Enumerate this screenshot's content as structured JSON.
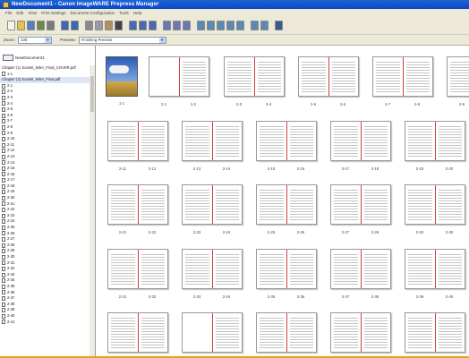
{
  "window": {
    "title": "NewDocument1 - Canon ImageWARE Prepress Manager"
  },
  "menu": [
    "File",
    "Edit",
    "View",
    "Print Settings",
    "Document Configuration",
    "Tools",
    "Help"
  ],
  "toolbar": {
    "buttons": [
      {
        "icon": "new-document-icon",
        "color": "#f5f5f0"
      },
      {
        "icon": "open-folder-icon",
        "color": "#e6c247"
      },
      {
        "icon": "save-icon",
        "color": "#5b7cc4"
      },
      {
        "icon": "scan-icon",
        "color": "#6a8a4a"
      },
      {
        "icon": "print-icon",
        "color": "#7a7a7a"
      },
      {
        "icon": "undo-icon",
        "color": "#3a6ab0"
      },
      {
        "icon": "redo-icon",
        "color": "#3a6ab0"
      },
      {
        "icon": "cut-icon",
        "color": "#8a8a8a"
      },
      {
        "icon": "copy-icon",
        "color": "#9a9aa8"
      },
      {
        "icon": "paste-icon",
        "color": "#b09060"
      },
      {
        "icon": "delete-icon",
        "color": "#444444"
      },
      {
        "icon": "insert-page-icon",
        "color": "#4a6ab0"
      },
      {
        "icon": "insert-blank-icon",
        "color": "#4a6ab0"
      },
      {
        "icon": "insert-sheet-icon",
        "color": "#4a6ab0"
      },
      {
        "icon": "chapter-icon",
        "color": "#6a7ab0"
      },
      {
        "icon": "merge-chapter-icon",
        "color": "#6a7ab0"
      },
      {
        "icon": "split-chapter-icon",
        "color": "#6a7ab0"
      },
      {
        "icon": "finishing-icon",
        "color": "#5a8ab0"
      },
      {
        "icon": "tab-paper-icon",
        "color": "#5a8ab0"
      },
      {
        "icon": "page-settings-icon",
        "color": "#5a8ab0"
      },
      {
        "icon": "paper-settings-icon",
        "color": "#5a8ab0"
      },
      {
        "icon": "edit-page-icon",
        "color": "#5a8ab0"
      },
      {
        "icon": "preview-icon",
        "color": "#5a8ab0"
      },
      {
        "icon": "properties-icon",
        "color": "#5a8ab0"
      },
      {
        "icon": "help-icon",
        "color": "#3a5a90"
      }
    ]
  },
  "viewbar": {
    "zoom_label": "Zoom:",
    "zoom_value": "100",
    "preview_label": "Preview:",
    "preview_value": "Finishing Preview"
  },
  "sidebar": {
    "document_name": "NewDocument1",
    "tree": [
      {
        "type": "chapter",
        "label": "Chapter (1) Scarlet_letter_Final_COVER.pdf"
      },
      {
        "type": "page",
        "label": "1-1"
      },
      {
        "type": "chapter",
        "label": "Chapter (2) Scarlet_letter_Final.pdf"
      },
      {
        "type": "page",
        "label": "2-1"
      },
      {
        "type": "page",
        "label": "2-2"
      },
      {
        "type": "page",
        "label": "2-3"
      },
      {
        "type": "page",
        "label": "2-4"
      },
      {
        "type": "page",
        "label": "2-5"
      },
      {
        "type": "page",
        "label": "2-6"
      },
      {
        "type": "page",
        "label": "2-7"
      },
      {
        "type": "page",
        "label": "2-8"
      },
      {
        "type": "page",
        "label": "2-9"
      },
      {
        "type": "page",
        "label": "2-10"
      },
      {
        "type": "page",
        "label": "2-11"
      },
      {
        "type": "page",
        "label": "2-12"
      },
      {
        "type": "page",
        "label": "2-13"
      },
      {
        "type": "page",
        "label": "2-14"
      },
      {
        "type": "page",
        "label": "2-15"
      },
      {
        "type": "page",
        "label": "2-16"
      },
      {
        "type": "page",
        "label": "2-17"
      },
      {
        "type": "page",
        "label": "2-18"
      },
      {
        "type": "page",
        "label": "2-19"
      },
      {
        "type": "page",
        "label": "2-20"
      },
      {
        "type": "page",
        "label": "2-21"
      },
      {
        "type": "page",
        "label": "2-22"
      },
      {
        "type": "page",
        "label": "2-23"
      },
      {
        "type": "page",
        "label": "2-24"
      },
      {
        "type": "page",
        "label": "2-25"
      },
      {
        "type": "page",
        "label": "2-26"
      },
      {
        "type": "page",
        "label": "2-27"
      },
      {
        "type": "page",
        "label": "2-28"
      },
      {
        "type": "page",
        "label": "2-29"
      },
      {
        "type": "page",
        "label": "2-30"
      },
      {
        "type": "page",
        "label": "2-31"
      },
      {
        "type": "page",
        "label": "2-32"
      },
      {
        "type": "page",
        "label": "2-33"
      },
      {
        "type": "page",
        "label": "2-34"
      },
      {
        "type": "page",
        "label": "2-35"
      },
      {
        "type": "page",
        "label": "2-36"
      },
      {
        "type": "page",
        "label": "2-37"
      },
      {
        "type": "page",
        "label": "2-38"
      },
      {
        "type": "page",
        "label": "2-39"
      },
      {
        "type": "page",
        "label": "2-40"
      },
      {
        "type": "page",
        "label": "2-41"
      }
    ]
  },
  "thumbnails": {
    "rows": [
      [
        {
          "kind": "cover",
          "labels": [
            "1-1"
          ]
        },
        {
          "kind": "spread",
          "blank_left": true,
          "labels": [
            "2-1",
            "2-2"
          ]
        },
        {
          "kind": "spread",
          "labels": [
            "2-3",
            "2-4"
          ]
        },
        {
          "kind": "spread",
          "labels": [
            "2-5",
            "2-6"
          ]
        },
        {
          "kind": "spread",
          "labels": [
            "2-7",
            "2-8"
          ]
        },
        {
          "kind": "spread",
          "labels": [
            "2-9"
          ]
        }
      ],
      [
        {
          "kind": "spread",
          "labels": [
            "2-11",
            "2-12"
          ]
        },
        {
          "kind": "spread",
          "labels": [
            "2-13",
            "2-14"
          ]
        },
        {
          "kind": "spread",
          "labels": [
            "2-15",
            "2-16"
          ]
        },
        {
          "kind": "spread",
          "labels": [
            "2-17",
            "2-18"
          ]
        },
        {
          "kind": "spread",
          "labels": [
            "2-19",
            "2-20"
          ]
        }
      ],
      [
        {
          "kind": "spread",
          "labels": [
            "2-21",
            "2-22"
          ]
        },
        {
          "kind": "spread",
          "labels": [
            "2-23",
            "2-24"
          ]
        },
        {
          "kind": "spread",
          "labels": [
            "2-25",
            "2-26"
          ]
        },
        {
          "kind": "spread",
          "labels": [
            "2-27",
            "2-28"
          ]
        },
        {
          "kind": "spread",
          "labels": [
            "2-29",
            "2-30"
          ]
        }
      ],
      [
        {
          "kind": "spread",
          "labels": [
            "2-31",
            "2-32"
          ]
        },
        {
          "kind": "spread",
          "labels": [
            "2-33",
            "2-34"
          ]
        },
        {
          "kind": "spread",
          "labels": [
            "2-35",
            "2-36"
          ]
        },
        {
          "kind": "spread",
          "labels": [
            "2-37",
            "2-38"
          ]
        },
        {
          "kind": "spread",
          "labels": [
            "2-39",
            "2-40"
          ]
        }
      ],
      [
        {
          "kind": "spread",
          "labels": []
        },
        {
          "kind": "spread",
          "blank_left": true,
          "labels": []
        },
        {
          "kind": "spread",
          "labels": []
        },
        {
          "kind": "spread",
          "labels": []
        },
        {
          "kind": "spread",
          "labels": []
        }
      ]
    ]
  },
  "colors": {
    "title_bar": "#0a49c4",
    "chrome": "#ece9d8",
    "gutter": "#d04040",
    "accent_bottom": "#e8a21a"
  }
}
